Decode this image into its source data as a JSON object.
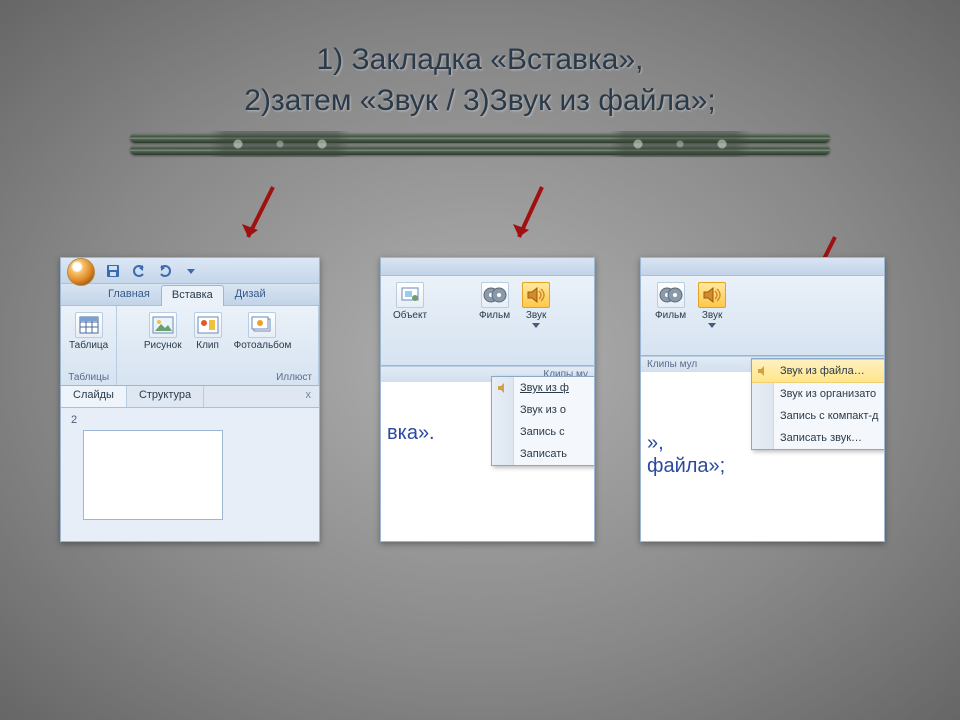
{
  "title_line1": "1) Закладка «Вставка»,",
  "title_line2": "2)затем  «Звук / 3)Звук из файла»;",
  "steps": {
    "n1": "1",
    "n2": "2",
    "n3": "3"
  },
  "shot1": {
    "tabs": {
      "home": "Главная",
      "insert": "Вставка",
      "design": "Дизай"
    },
    "groups": {
      "tables": {
        "caption": "Таблицы",
        "btn": "Таблица"
      },
      "illus": {
        "caption": "Иллюст",
        "picture": "Рисунок",
        "clip": "Клип",
        "album": "Фотоальбом"
      }
    },
    "nav": {
      "slides": "Слайды",
      "outline": "Структура",
      "close": "x"
    },
    "slide_num": "2"
  },
  "shot2": {
    "object_btn": "Объект",
    "movie_btn": "Фильм",
    "sound_btn": "Звук",
    "group_caption": "Клипы му",
    "menu": {
      "from_file": "Звук из ф",
      "from_org": "Звук из о",
      "record": "Запись с",
      "write": "Записать"
    },
    "body_text": "вка»."
  },
  "shot3": {
    "movie_btn": "Фильм",
    "sound_btn": "Звук",
    "group_caption": "Клипы мул",
    "menu": {
      "from_file": "Звук из файла…",
      "from_org": "Звук из организато",
      "from_cd": "Запись с компакт-д",
      "record": "Записать звук…"
    },
    "body_line1": "»,",
    "body_line2": "файла»;"
  }
}
